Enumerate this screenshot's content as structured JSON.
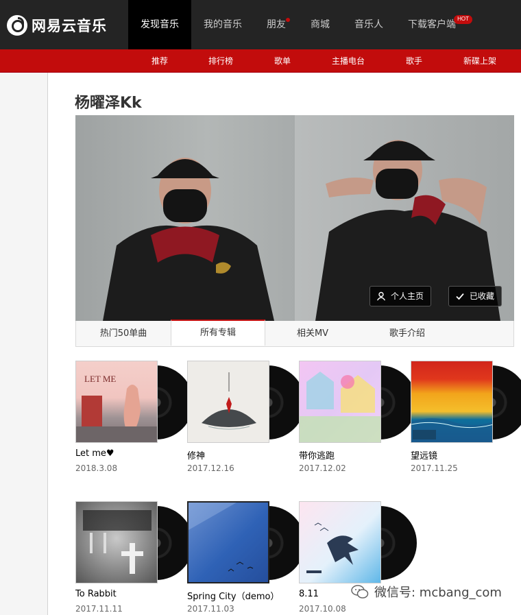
{
  "logo": {
    "text": "网易云音乐"
  },
  "nav": [
    {
      "label": "发现音乐",
      "active": true
    },
    {
      "label": "我的音乐"
    },
    {
      "label": "朋友",
      "dot": true
    },
    {
      "label": "商城"
    },
    {
      "label": "音乐人"
    },
    {
      "label": "下载客户端",
      "badge": "HOT"
    }
  ],
  "subnav": [
    "推荐",
    "排行榜",
    "歌单",
    "主播电台",
    "歌手",
    "新碟上架"
  ],
  "artist": {
    "name": "杨曜泽Kk",
    "home_button": "个人主页",
    "fav_button": "已收藏"
  },
  "tabs": [
    "热门50单曲",
    "所有专辑",
    "相关MV",
    "歌手介绍"
  ],
  "active_tab": 1,
  "albums": [
    {
      "title": "Let me♥",
      "date": "2018.3.08"
    },
    {
      "title": "修神",
      "date": "2017.12.16"
    },
    {
      "title": "带你逃跑",
      "date": "2017.12.02"
    },
    {
      "title": "望远镜",
      "date": "2017.11.25"
    },
    {
      "title": "To Rabbit",
      "date": "2017.11.11"
    },
    {
      "title": "Spring City（demo）",
      "date": "2017.11.03"
    },
    {
      "title": "8.11",
      "date": "2017.10.08"
    }
  ],
  "watermark": "微信号: mcbang_com"
}
